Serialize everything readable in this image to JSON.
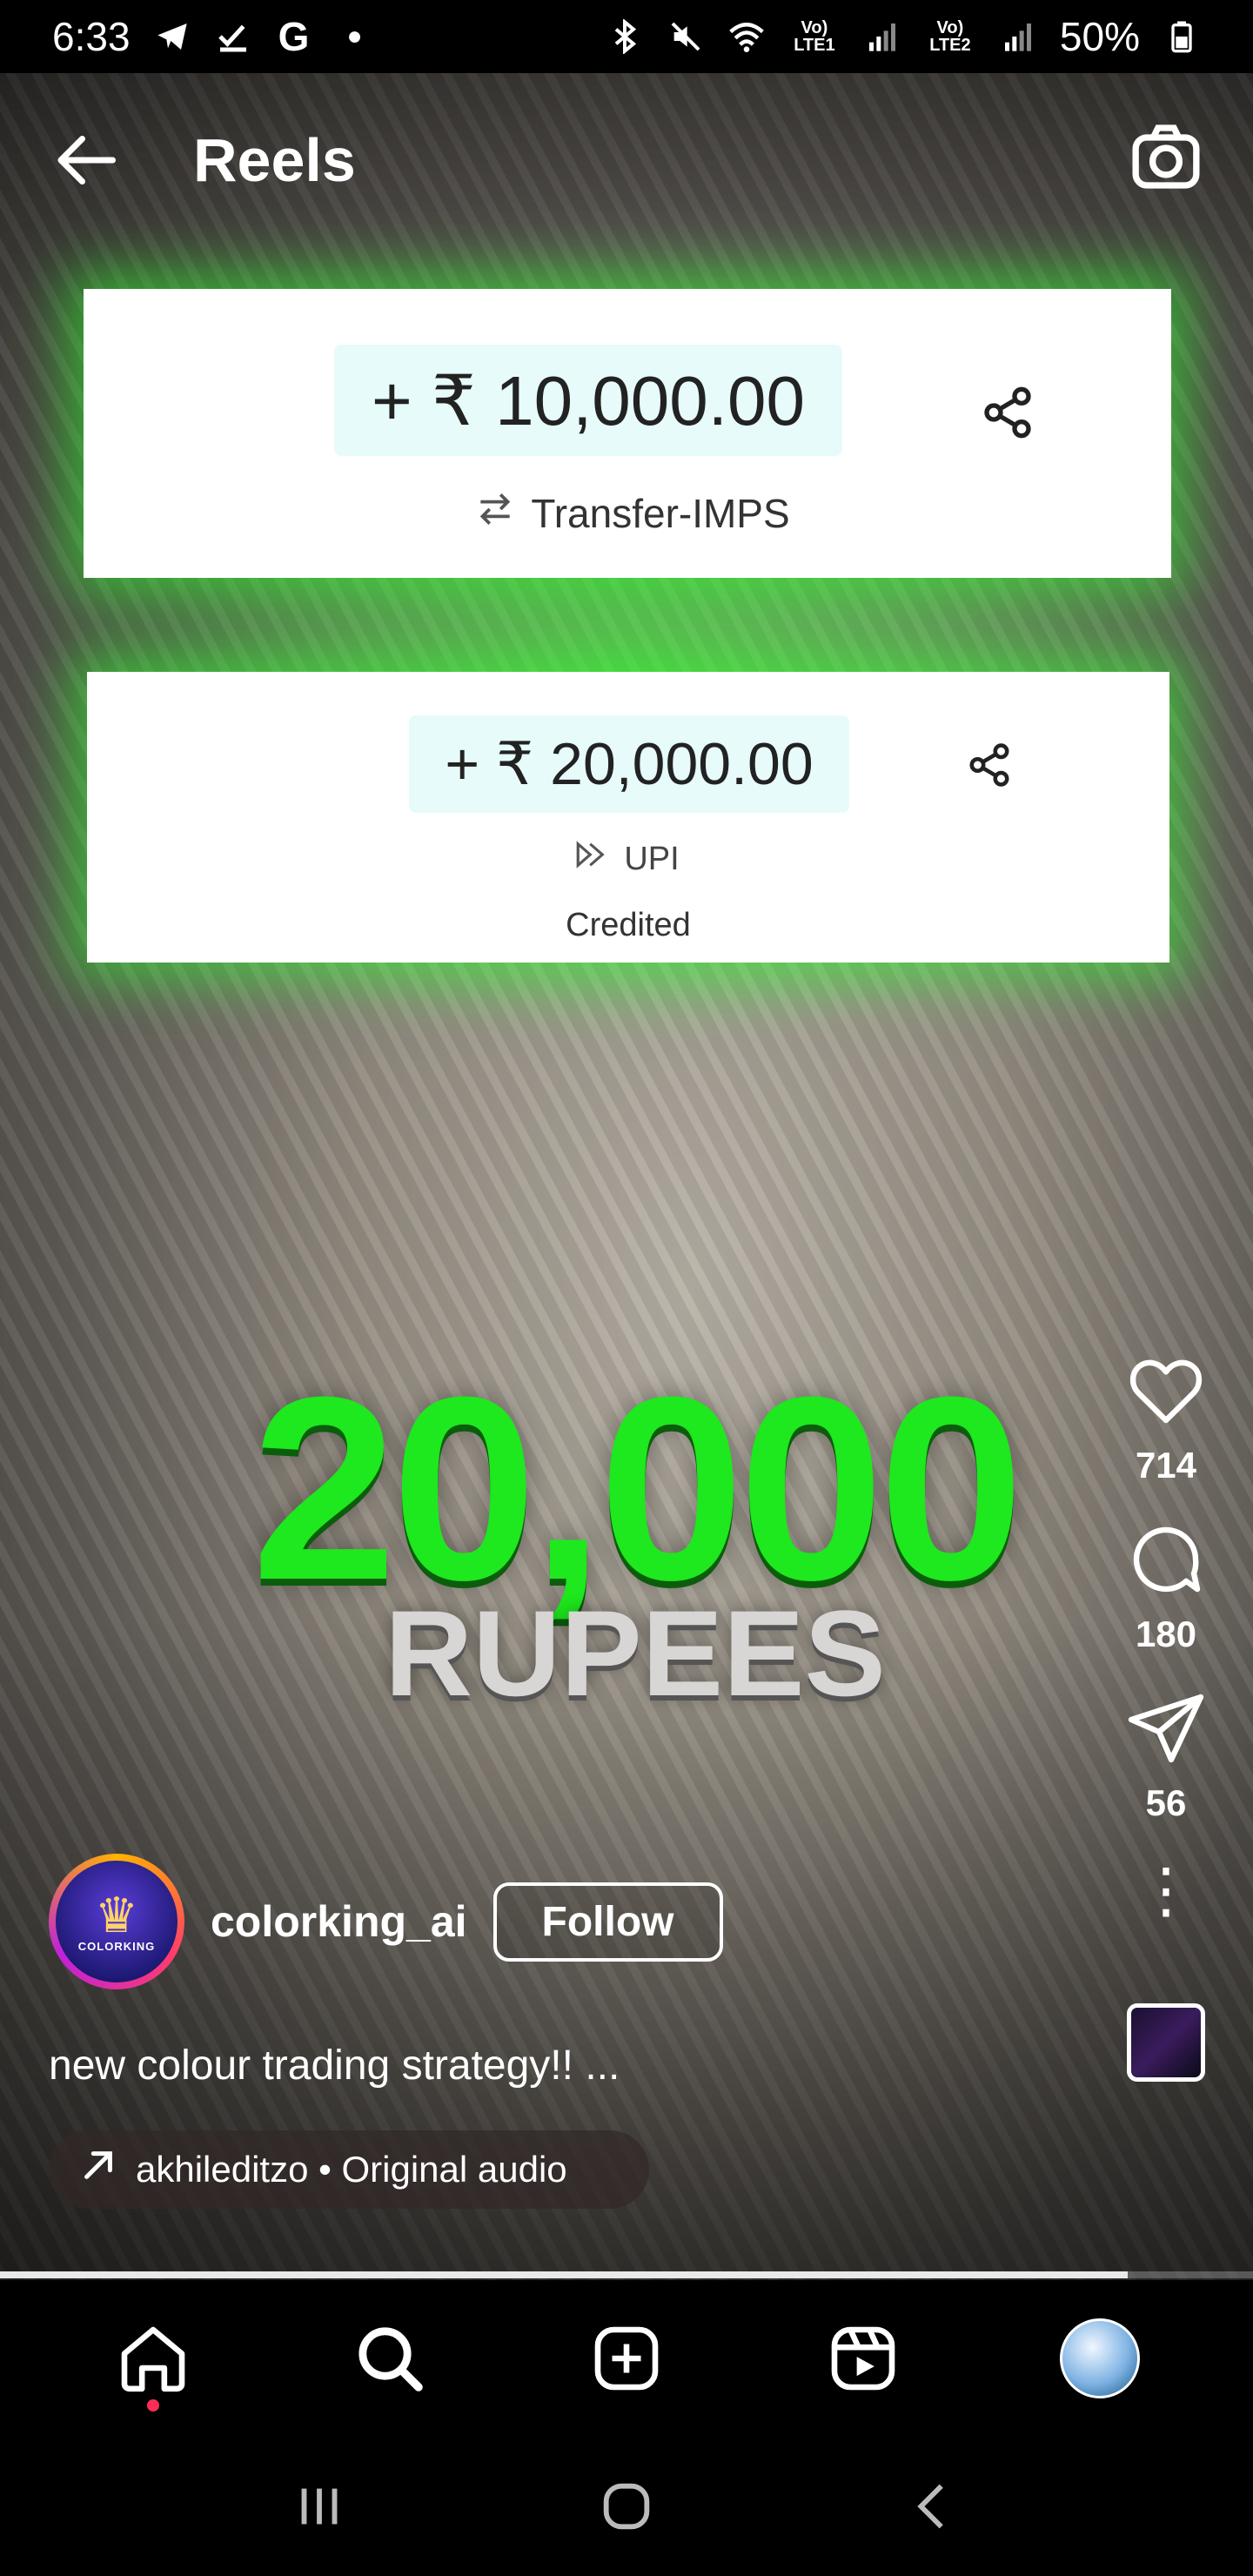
{
  "status_bar": {
    "time": "6:33",
    "battery": "50%",
    "sim1_label": "Vo) LTE1",
    "sim2_label": "Vo) LTE2"
  },
  "header": {
    "title": "Reels"
  },
  "reel": {
    "cards": [
      {
        "amount": "+ ₹ 10,000.00",
        "method": "Transfer-IMPS"
      },
      {
        "amount": "+ ₹ 20,000.00",
        "method": "UPI",
        "status": "Credited"
      }
    ],
    "headline_number": "20,000",
    "headline_unit": "RUPEES"
  },
  "actions": {
    "likes": "714",
    "comments": "180",
    "shares": "56"
  },
  "author": {
    "username": "colorking_ai",
    "follow_label": "Follow",
    "avatar_text": "COLORKING"
  },
  "caption": "new colour trading strategy!! ...",
  "audio": {
    "label": "akhileditzo • Original audio"
  },
  "progress": 0.9,
  "colors": {
    "accent_green": "#1ee81e",
    "notification_dot": "#ff2d55"
  },
  "icons": {
    "nav": [
      "home-icon",
      "search-icon",
      "create-icon",
      "reels-icon",
      "profile-avatar"
    ],
    "system": [
      "recent-apps-icon",
      "home-button-icon",
      "back-button-icon"
    ]
  }
}
